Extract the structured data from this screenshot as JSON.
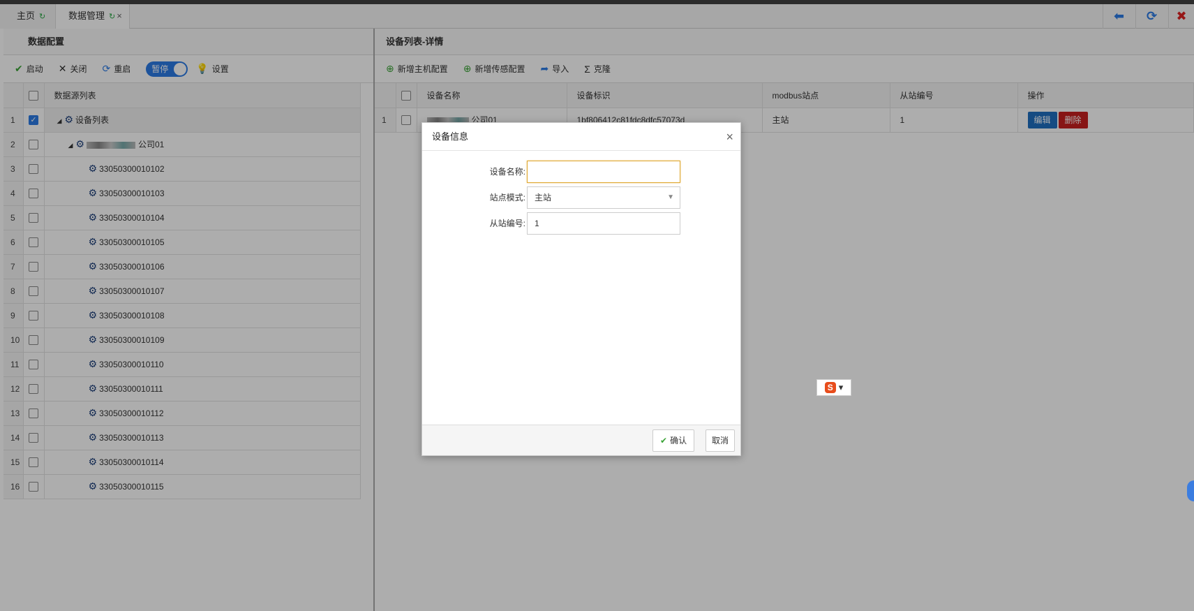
{
  "tabs": [
    {
      "label": "主页"
    },
    {
      "label": "数据管理"
    }
  ],
  "left": {
    "title": "数据配置",
    "toolbar": {
      "start": "启动",
      "close": "关闭",
      "restart": "重启",
      "pause": "暂停",
      "settings": "设置"
    },
    "column": "数据源列表",
    "rows": [
      {
        "n": "1",
        "label": "设备列表"
      },
      {
        "n": "2",
        "label": "公司01"
      },
      {
        "n": "3",
        "label": "33050300010102"
      },
      {
        "n": "4",
        "label": "33050300010103"
      },
      {
        "n": "5",
        "label": "33050300010104"
      },
      {
        "n": "6",
        "label": "33050300010105"
      },
      {
        "n": "7",
        "label": "33050300010106"
      },
      {
        "n": "8",
        "label": "33050300010107"
      },
      {
        "n": "9",
        "label": "33050300010108"
      },
      {
        "n": "10",
        "label": "33050300010109"
      },
      {
        "n": "11",
        "label": "33050300010110"
      },
      {
        "n": "12",
        "label": "33050300010111"
      },
      {
        "n": "13",
        "label": "33050300010112"
      },
      {
        "n": "14",
        "label": "33050300010113"
      },
      {
        "n": "15",
        "label": "33050300010114"
      },
      {
        "n": "16",
        "label": "33050300010115"
      }
    ]
  },
  "right": {
    "title": "设备列表-详情",
    "toolbar": {
      "add_host": "新增主机配置",
      "add_sensor": "新增传感配置",
      "import": "导入",
      "clone": "克隆"
    },
    "columns": [
      "设备名称",
      "设备标识",
      "modbus站点",
      "从站编号",
      "操作"
    ],
    "row": {
      "n": "1",
      "name": "公司01",
      "id": "1bf806412c81fdc8dfc57073d",
      "site": "主站",
      "slave": "1",
      "edit": "编辑",
      "delete": "删除"
    }
  },
  "dialog": {
    "title": "设备信息",
    "name_label": "设备名称:",
    "name_value": "",
    "mode_label": "站点模式:",
    "mode_value": "主站",
    "slave_label": "从站编号:",
    "slave_value": "1",
    "confirm": "确认",
    "cancel": "取消"
  },
  "colors": {
    "primary": "#2c7be5",
    "danger": "#c72020",
    "edit": "#1f6fc0"
  }
}
